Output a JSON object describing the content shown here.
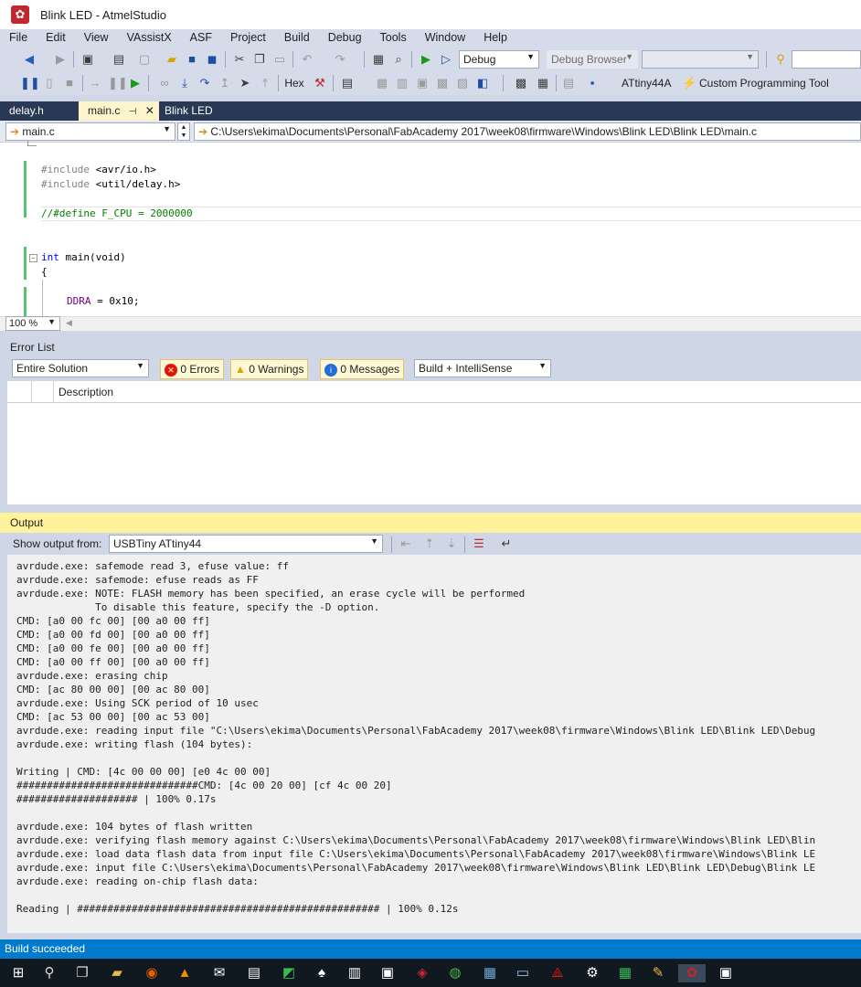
{
  "window": {
    "title": "Blink LED - AtmelStudio"
  },
  "menu": [
    "File",
    "Edit",
    "View",
    "VAssistX",
    "ASF",
    "Project",
    "Build",
    "Debug",
    "Tools",
    "Window",
    "Help"
  ],
  "toolbar1": {
    "config": "Debug",
    "debug_browser": "Debug Browser"
  },
  "toolbar2": {
    "hex_label": "Hex",
    "device": "ATtiny44A",
    "tool": "Custom Programming Tool"
  },
  "tabs": [
    {
      "label": "delay.h",
      "active": false
    },
    {
      "label": "main.c",
      "pin": "⊣",
      "close": "✕",
      "active": true
    },
    {
      "label": "Blink LED",
      "active": false
    }
  ],
  "navbar": {
    "file": "main.c",
    "path": "C:\\Users\\ekima\\Documents\\Personal\\FabAcademy 2017\\week08\\firmware\\Windows\\Blink LED\\Blink LED\\main.c"
  },
  "code": {
    "include1_kw": "#include",
    "include1_arg": " <avr/io.h>",
    "include2_kw": "#include",
    "include2_arg": " <util/delay.h>",
    "define": "//#define F_CPU = 2000000",
    "main_kw": "int",
    "main_rest": " main(void)",
    "brace": "{",
    "ddra_reg": "DDRA",
    "ddra_rest": " = 0x10;"
  },
  "zoom": "100 %",
  "error_list": {
    "title": "Error List",
    "scope": "Entire Solution",
    "errors": "0 Errors",
    "warnings": "0 Warnings",
    "messages": "0 Messages",
    "filter": "Build + IntelliSense",
    "col_description": "Description"
  },
  "output": {
    "title": "Output",
    "show_from_label": "Show output from:",
    "source": "USBTiny ATtiny44",
    "lines": [
      "avrdude.exe: safemode read 3, efuse value: ff",
      "avrdude.exe: safemode: efuse reads as FF",
      "avrdude.exe: NOTE: FLASH memory has been specified, an erase cycle will be performed",
      "             To disable this feature, specify the -D option.",
      "CMD: [a0 00 fc 00] [00 a0 00 ff]",
      "CMD: [a0 00 fd 00] [00 a0 00 ff]",
      "CMD: [a0 00 fe 00] [00 a0 00 ff]",
      "CMD: [a0 00 ff 00] [00 a0 00 ff]",
      "avrdude.exe: erasing chip",
      "CMD: [ac 80 00 00] [00 ac 80 00]",
      "avrdude.exe: Using SCK period of 10 usec",
      "CMD: [ac 53 00 00] [00 ac 53 00]",
      "avrdude.exe: reading input file \"C:\\Users\\ekima\\Documents\\Personal\\FabAcademy 2017\\week08\\firmware\\Windows\\Blink LED\\Blink LED\\Debug",
      "avrdude.exe: writing flash (104 bytes):",
      "",
      "Writing | CMD: [4c 00 00 00] [e0 4c 00 00]",
      "##############################CMD: [4c 00 20 00] [cf 4c 00 20]",
      "#################### | 100% 0.17s",
      "",
      "avrdude.exe: 104 bytes of flash written",
      "avrdude.exe: verifying flash memory against C:\\Users\\ekima\\Documents\\Personal\\FabAcademy 2017\\week08\\firmware\\Windows\\Blink LED\\Blin",
      "avrdude.exe: load data flash data from input file C:\\Users\\ekima\\Documents\\Personal\\FabAcademy 2017\\week08\\firmware\\Windows\\Blink LE",
      "avrdude.exe: input file C:\\Users\\ekima\\Documents\\Personal\\FabAcademy 2017\\week08\\firmware\\Windows\\Blink LED\\Blink LED\\Debug\\Blink LE",
      "avrdude.exe: reading on-chip flash data:",
      "",
      "Reading | ################################################## | 100% 0.12s"
    ]
  },
  "status": "Build succeeded",
  "colors": {
    "statusbar": "#007acc",
    "tabbar": "#293955",
    "output_header": "#fff29d"
  }
}
